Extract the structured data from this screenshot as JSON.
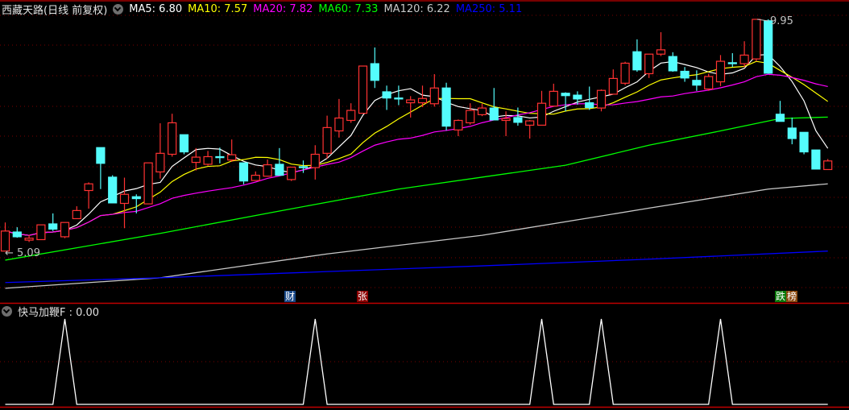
{
  "header": {
    "title": "西藏天路(日线 前复权)",
    "ma": [
      {
        "label": "MA5: 6.80",
        "color": "#ffffff"
      },
      {
        "label": "MA10: 7.57",
        "color": "#ffff00"
      },
      {
        "label": "MA20: 7.82",
        "color": "#ff00ff"
      },
      {
        "label": "MA60: 7.33",
        "color": "#00ff00"
      },
      {
        "label": "MA120: 6.22",
        "color": "#c8c8c8"
      },
      {
        "label": "MA250: 5.11",
        "color": "#0000ff"
      }
    ]
  },
  "price_labels": {
    "high": "9.95",
    "low": "← 5.09"
  },
  "tags": [
    {
      "text": "财",
      "color": "#1a4a8a"
    },
    {
      "text": "张",
      "color": "#8b0000"
    },
    {
      "text": "跌",
      "color": "#0a7a0a"
    },
    {
      "text": "榜",
      "color": "#8b4a10"
    }
  ],
  "indicator": {
    "title": "快马加鞭F : 0.00"
  },
  "chart_data": {
    "type": "candlestick",
    "up_color": "#ff3232",
    "down_color": "#54fcfc",
    "candles_ohlc": [
      [
        5.09,
        5.69,
        5.09,
        5.51
      ],
      [
        5.49,
        5.59,
        5.37,
        5.39
      ],
      [
        5.32,
        5.43,
        5.28,
        5.36
      ],
      [
        5.33,
        5.64,
        5.33,
        5.64
      ],
      [
        5.66,
        5.88,
        5.51,
        5.55
      ],
      [
        5.39,
        5.69,
        5.36,
        5.69
      ],
      [
        5.77,
        6.03,
        5.77,
        5.94
      ],
      [
        6.36,
        6.53,
        5.98,
        6.5
      ],
      [
        7.26,
        7.26,
        6.39,
        6.93
      ],
      [
        6.64,
        6.68,
        6.1,
        6.1
      ],
      [
        6.09,
        6.63,
        5.57,
        6.28
      ],
      [
        6.23,
        6.28,
        5.88,
        6.19
      ],
      [
        6.08,
        6.94,
        6.08,
        6.94
      ],
      [
        6.75,
        7.77,
        6.61,
        7.14
      ],
      [
        7.12,
        7.97,
        7.07,
        7.78
      ],
      [
        7.53,
        7.53,
        7.12,
        7.17
      ],
      [
        6.95,
        7.25,
        6.78,
        7.06
      ],
      [
        6.91,
        7.19,
        6.88,
        7.07
      ],
      [
        7.07,
        7.26,
        6.93,
        7.06
      ],
      [
        7.0,
        7.43,
        6.96,
        7.11
      ],
      [
        6.94,
        6.94,
        6.49,
        6.56
      ],
      [
        6.57,
        6.76,
        6.57,
        6.68
      ],
      [
        6.66,
        7.01,
        6.66,
        6.9
      ],
      [
        6.91,
        7.25,
        6.68,
        6.68
      ],
      [
        6.59,
        6.85,
        6.56,
        6.85
      ],
      [
        6.86,
        6.99,
        6.73,
        6.85
      ],
      [
        6.84,
        7.31,
        6.59,
        7.12
      ],
      [
        7.14,
        7.93,
        7.03,
        7.68
      ],
      [
        7.61,
        8.28,
        7.47,
        7.88
      ],
      [
        7.83,
        8.19,
        7.78,
        8.04
      ],
      [
        7.98,
        8.97,
        7.98,
        8.97
      ],
      [
        9.02,
        9.36,
        8.51,
        8.67
      ],
      [
        8.43,
        8.56,
        8.05,
        8.3
      ],
      [
        8.3,
        8.56,
        8.15,
        8.28
      ],
      [
        8.2,
        8.34,
        7.89,
        8.26
      ],
      [
        8.2,
        8.56,
        8.11,
        8.29
      ],
      [
        8.18,
        8.8,
        8.12,
        8.51
      ],
      [
        8.51,
        8.62,
        7.62,
        7.71
      ],
      [
        7.63,
        7.85,
        7.5,
        7.83
      ],
      [
        7.78,
        8.19,
        7.74,
        8.04
      ],
      [
        7.95,
        8.18,
        7.92,
        8.09
      ],
      [
        8.09,
        8.51,
        7.84,
        7.84
      ],
      [
        7.83,
        8.02,
        7.5,
        7.87
      ],
      [
        7.89,
        8.1,
        7.72,
        7.79
      ],
      [
        7.73,
        7.84,
        7.45,
        7.82
      ],
      [
        7.73,
        8.45,
        7.73,
        8.19
      ],
      [
        8.13,
        8.6,
        8.13,
        8.44
      ],
      [
        8.4,
        8.42,
        8.02,
        8.35
      ],
      [
        8.36,
        8.44,
        8.16,
        8.28
      ],
      [
        8.2,
        8.54,
        8.05,
        8.1
      ],
      [
        8.09,
        8.48,
        8.02,
        8.46
      ],
      [
        8.38,
        8.9,
        8.38,
        8.71
      ],
      [
        8.61,
        9.06,
        8.57,
        9.03
      ],
      [
        9.27,
        9.53,
        8.85,
        8.89
      ],
      [
        8.81,
        9.22,
        8.72,
        9.22
      ],
      [
        9.22,
        9.68,
        9.18,
        9.31
      ],
      [
        9.17,
        9.26,
        8.85,
        8.87
      ],
      [
        8.86,
        8.95,
        8.64,
        8.72
      ],
      [
        8.67,
        8.88,
        8.45,
        8.57
      ],
      [
        8.49,
        8.81,
        8.45,
        8.75
      ],
      [
        8.64,
        9.2,
        8.55,
        9.07
      ],
      [
        9.04,
        9.24,
        8.95,
        9.02
      ],
      [
        9.02,
        9.49,
        8.95,
        9.2
      ],
      [
        9.12,
        9.95,
        9.07,
        9.95
      ],
      [
        9.92,
        9.95,
        8.82,
        8.82
      ],
      [
        7.96,
        8.24,
        7.81,
        7.81
      ],
      [
        7.67,
        7.89,
        7.33,
        7.45
      ],
      [
        7.58,
        7.58,
        7.12,
        7.17
      ],
      [
        7.21,
        7.21,
        6.81,
        6.81
      ],
      [
        6.8,
        7.02,
        6.8,
        6.98
      ]
    ],
    "computed_ma": [
      {
        "period": 5,
        "color": "#ffffff"
      },
      {
        "period": 10,
        "color": "#ffff00"
      },
      {
        "period": 20,
        "color": "#ff00ff"
      }
    ],
    "long_ma_points": [
      {
        "period": 60,
        "color": "#00ff00",
        "points": [
          [
            0,
            4.9
          ],
          [
            13,
            5.46
          ],
          [
            23,
            5.93
          ],
          [
            33,
            6.39
          ],
          [
            40,
            6.64
          ],
          [
            47,
            6.89
          ],
          [
            54,
            7.31
          ],
          [
            60,
            7.61
          ],
          [
            65,
            7.87
          ],
          [
            69,
            7.9
          ]
        ]
      },
      {
        "period": 120,
        "color": "#c8c8c8",
        "points": [
          [
            0,
            4.31
          ],
          [
            13,
            4.53
          ],
          [
            27,
            5.03
          ],
          [
            40,
            5.42
          ],
          [
            54,
            5.99
          ],
          [
            64,
            6.39
          ],
          [
            69,
            6.5
          ]
        ]
      },
      {
        "period": 250,
        "color": "#0000ff",
        "points": [
          [
            0,
            4.43
          ],
          [
            13,
            4.53
          ],
          [
            27,
            4.66
          ],
          [
            40,
            4.78
          ],
          [
            54,
            4.92
          ],
          [
            69,
            5.09
          ]
        ]
      }
    ],
    "price_range": [
      4.2,
      10.1
    ],
    "tag_bars": [
      24,
      30,
      65,
      66
    ],
    "indicator_values": [
      0,
      0,
      0,
      0,
      0,
      1,
      0,
      0,
      0,
      0,
      0,
      0,
      0,
      0,
      0,
      0,
      0,
      0,
      0,
      0,
      0,
      0,
      0,
      0,
      0,
      0,
      1,
      0,
      0,
      0,
      0,
      0,
      0,
      0,
      0,
      0,
      0,
      0,
      0,
      0,
      0,
      0,
      0,
      0,
      0,
      1,
      0,
      0,
      0,
      0,
      1,
      0,
      0,
      0,
      0,
      0,
      0,
      0,
      0,
      0,
      1,
      0,
      0,
      0,
      0,
      0,
      0,
      0,
      0,
      0
    ],
    "indicator_range": [
      0,
      1
    ],
    "grid": true
  }
}
